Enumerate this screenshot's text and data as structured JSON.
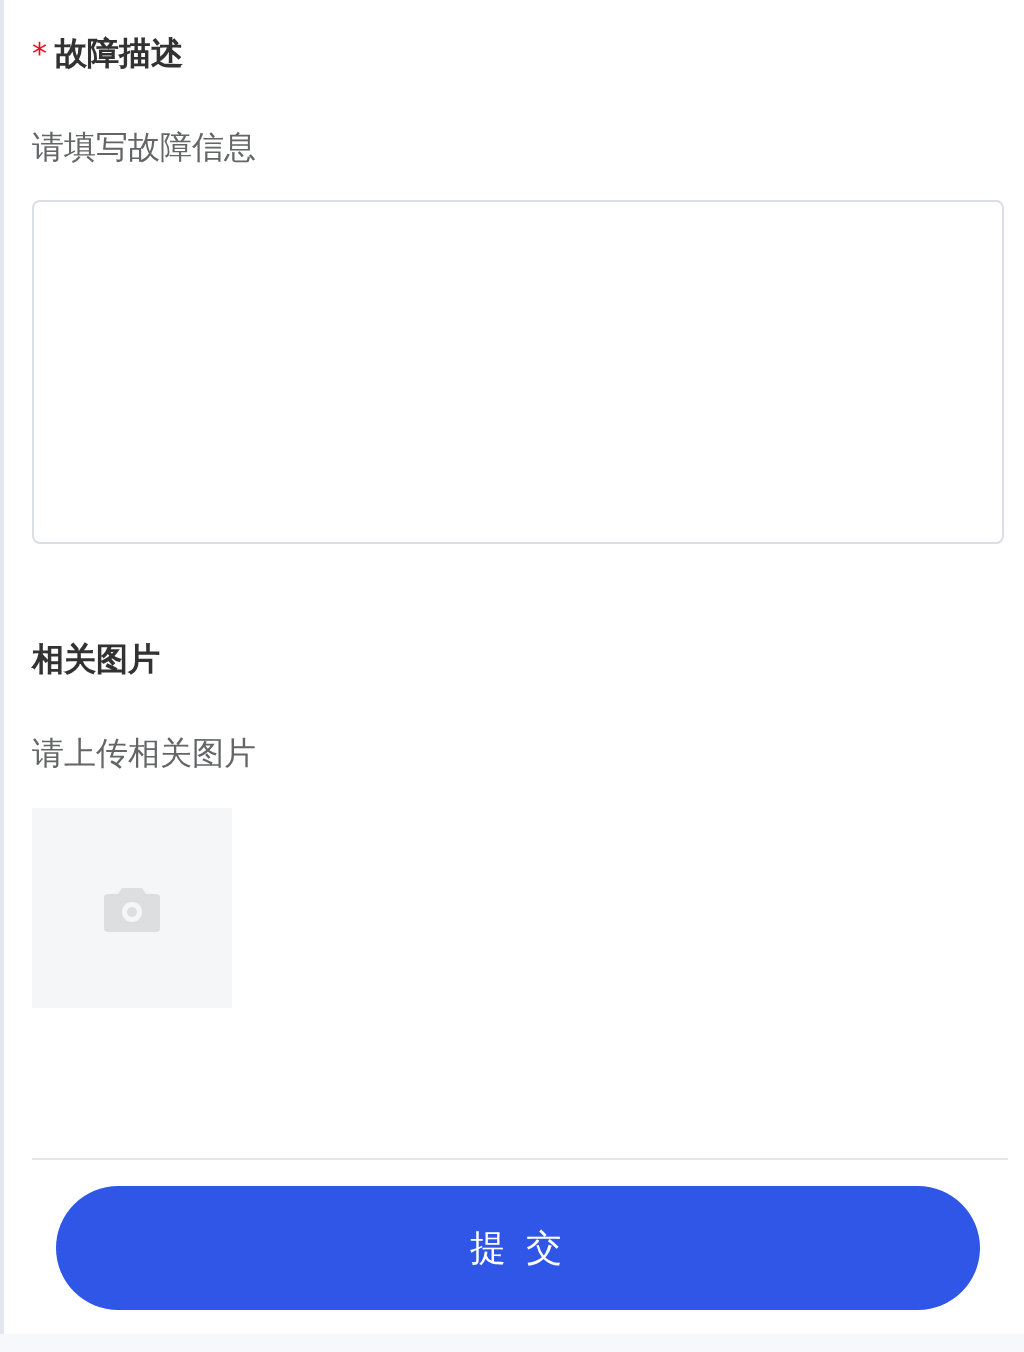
{
  "sections": [
    {
      "kind": "textarea",
      "required_mark": "*",
      "title": "故障描述",
      "hint": "请填写故障信息"
    },
    {
      "kind": "upload",
      "title": "相关图片",
      "hint": "请上传相关图片"
    }
  ],
  "submit_button": "提 交"
}
